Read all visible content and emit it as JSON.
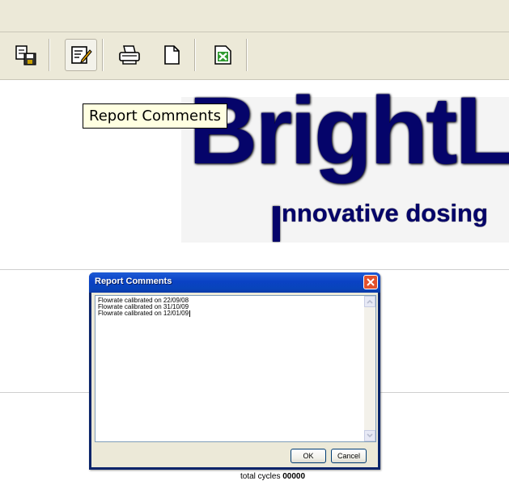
{
  "toolbar": {
    "buttons": [
      {
        "icon": "save-report-icon"
      },
      {
        "icon": "report-comments-icon"
      },
      {
        "icon": "print-icon"
      },
      {
        "icon": "new-document-icon"
      },
      {
        "icon": "export-excel-icon"
      }
    ]
  },
  "tooltip": {
    "text": "Report Comments"
  },
  "logo": {
    "name": "BrightLo",
    "tagline": "nnovative dosing"
  },
  "dialog": {
    "title": "Report Comments",
    "comments": [
      "Flowrate calibrated on 22/09/08",
      "Flowrate calibrated on 31/10/09",
      "Flowrate calibrated on 12/01/09"
    ],
    "ok_label": "OK",
    "cancel_label": "Cancel"
  },
  "footer": {
    "label": "total cycles",
    "value": "00000"
  },
  "colors": {
    "toolbar_bg": "#ece9d8",
    "logo_blue": "#05046a",
    "titlebar_blue": "#0a42c4",
    "close_red": "#e2512c",
    "tooltip_bg": "#ffffe1"
  }
}
